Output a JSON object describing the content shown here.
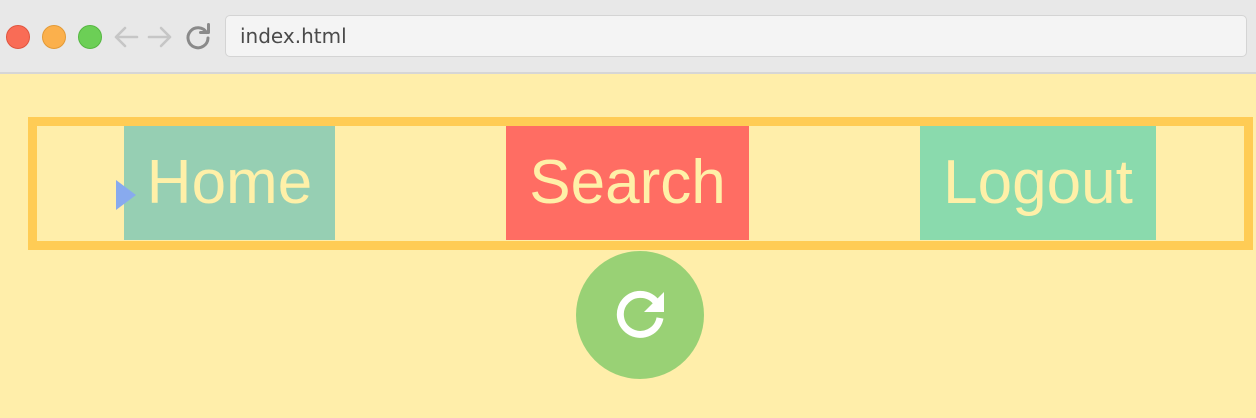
{
  "browser": {
    "address": "index.html",
    "window_controls": [
      "close",
      "minimize",
      "zoom"
    ],
    "icons": {
      "back": "arrow-left-icon",
      "forward": "arrow-right-icon",
      "reload": "reload-icon"
    }
  },
  "nav": {
    "items": [
      {
        "label": "Home",
        "color": "#96cfb3"
      },
      {
        "label": "Search",
        "color": "#ff6d63"
      },
      {
        "label": "Logout",
        "color": "#8adaad"
      }
    ],
    "border_color": "#ffcc55",
    "text_color": "#fff0a8"
  },
  "refresh": {
    "icon": "refresh-icon",
    "color": "#99d175"
  },
  "colors": {
    "page_background": "#ffeeaa",
    "cursor": "#88aaee"
  }
}
